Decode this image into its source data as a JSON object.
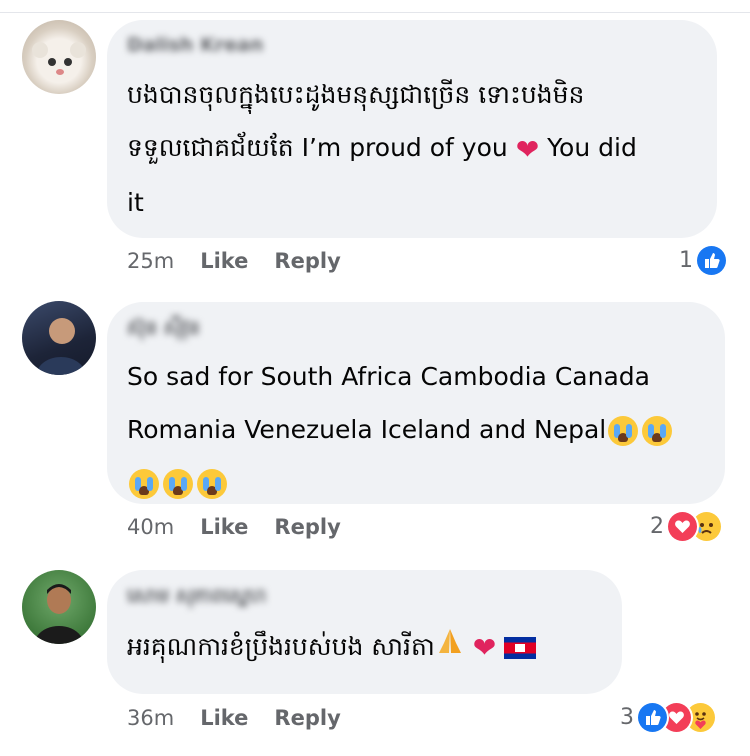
{
  "comments": [
    {
      "author": "Dalish Krean",
      "lines": [
        "បងបានចុលក្នុងបេះដូងមនុស្សជាច្រើន ទោះបងមិន",
        "ទទួលជោគជ័យតែ I’m proud of you",
        "it"
      ],
      "line2_tail": "You did",
      "time": "25m",
      "like": "Like",
      "reply": "Reply",
      "reaction_count": "1",
      "reactions": [
        "like-reaction"
      ]
    },
    {
      "author": "ស៊ុន ស៊ីវុន",
      "lines": [
        "So sad for South Africa Cambodia Canada",
        "Romania Venezuela Iceland and Nepal"
      ],
      "time": "40m",
      "like": "Like",
      "reply": "Reply",
      "reaction_count": "2",
      "reactions": [
        "love-reaction",
        "sad-reaction"
      ]
    },
    {
      "author": "សោម សុភាពស្នេហ",
      "lines": [
        "អរគុណការខំប្រឹងរបស់បង សារីតា"
      ],
      "time": "36m",
      "like": "Like",
      "reply": "Reply",
      "reaction_count": "3",
      "reactions": [
        "like-reaction",
        "love-reaction",
        "care-reaction"
      ]
    }
  ],
  "colors": {
    "like_blue": "#1877f2",
    "love_red": "#f33e58",
    "bubble_bg": "#f0f2f5",
    "meta_gray": "#65676b"
  }
}
